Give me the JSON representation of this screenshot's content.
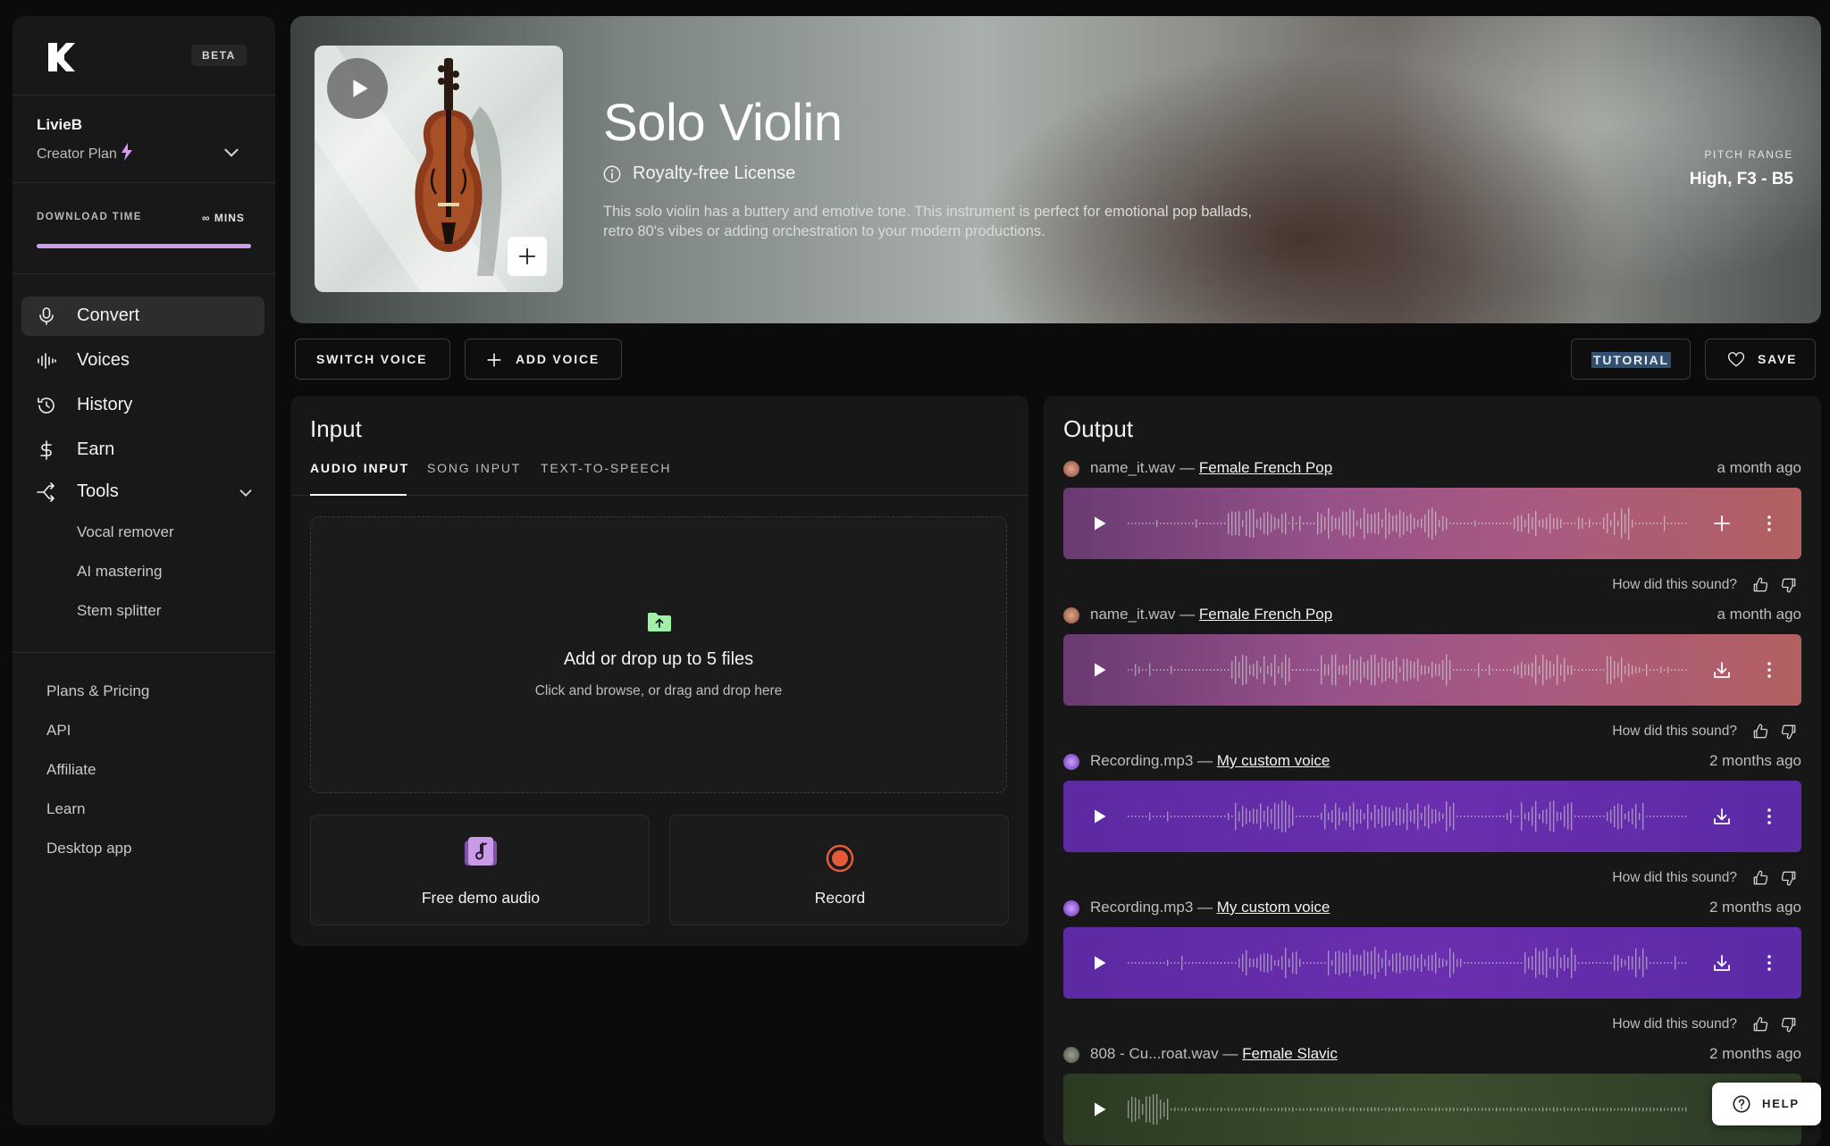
{
  "brand": {
    "beta_label": "BETA"
  },
  "account": {
    "name": "LivieB",
    "plan": "Creator Plan"
  },
  "download": {
    "label": "DOWNLOAD TIME",
    "value": "∞ MINS",
    "fill_fraction": 1.0
  },
  "nav": {
    "items": [
      {
        "label": "Convert",
        "icon": "microphone-icon",
        "active": true
      },
      {
        "label": "Voices",
        "icon": "waveform-icon",
        "active": false
      },
      {
        "label": "History",
        "icon": "history-icon",
        "active": false
      },
      {
        "label": "Earn",
        "icon": "dollar-icon",
        "active": false
      },
      {
        "label": "Tools",
        "icon": "tools-icon",
        "active": false
      }
    ],
    "tools_sub": [
      "Vocal remover",
      "AI mastering",
      "Stem splitter"
    ],
    "footer": [
      "Plans & Pricing",
      "API",
      "Affiliate",
      "Learn",
      "Desktop app"
    ]
  },
  "hero": {
    "title": "Solo Violin",
    "license": "Royalty-free License",
    "description": "This solo violin has a buttery and emotive tone. This instrument is perfect for emotional pop ballads, retro 80's vibes or adding orchestration to your modern productions.",
    "pitch_label": "PITCH RANGE",
    "pitch_value": "High, F3 - B5"
  },
  "actions": {
    "switch_voice": "SWITCH VOICE",
    "add_voice": "ADD VOICE",
    "tutorial": "TUTORIAL",
    "save": "SAVE"
  },
  "input": {
    "title": "Input",
    "tabs": [
      "AUDIO INPUT",
      "SONG INPUT",
      "TEXT-TO-SPEECH"
    ],
    "drop_title": "Add or drop up to 5 files",
    "drop_sub": "Click and browse, or drag and drop here",
    "demo_label": "Free demo audio",
    "record_label": "Record"
  },
  "output": {
    "title": "Output",
    "feedback_prompt": "How did this sound?",
    "items": [
      {
        "file": "name_it.wav — ",
        "voice": "Female French Pop",
        "time": "a month ago",
        "style": "pink",
        "action": "add"
      },
      {
        "file": "name_it.wav — ",
        "voice": "Female French Pop",
        "time": "a month ago",
        "style": "pink",
        "action": "download"
      },
      {
        "file": "Recording.mp3 — ",
        "voice": "My custom voice",
        "time": "2 months ago",
        "style": "purple",
        "action": "download"
      },
      {
        "file": "Recording.mp3 — ",
        "voice": "My custom voice",
        "time": "2 months ago",
        "style": "purple",
        "action": "download"
      },
      {
        "file": "808 - Cu...roat.wav — ",
        "voice": "Female Slavic",
        "time": "2 months ago",
        "style": "green",
        "action": "download"
      }
    ]
  },
  "help": {
    "label": "HELP"
  },
  "colors": {
    "accent": "#cf9df0",
    "pink_wave": "#965189",
    "purple_wave": "#6a2eaf",
    "green_wave": "#3d4e2f"
  }
}
